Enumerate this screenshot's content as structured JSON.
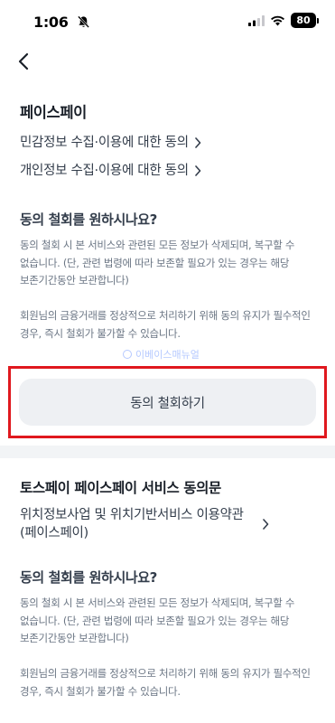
{
  "status_bar": {
    "time": "1:06",
    "battery": "80",
    "icons": [
      "bell-off-icon",
      "signal-icon",
      "wifi-icon",
      "battery-icon"
    ]
  },
  "nav": {
    "back_icon": "chevron-left-icon"
  },
  "face_pay": {
    "title": "페이스페이",
    "links": [
      "민감정보 수집·이용에 대한 동의",
      "개인정보 수집·이용에 대한 동의"
    ],
    "withdraw_question": "동의 철회를 원하시나요?",
    "paragraph1": "동의 철회 시 본 서비스와 관련된 모든 정보가 삭제되며, 복구할 수 없습니다. (단, 관련 법령에 따라 보존할 필요가 있는 경우는 해당 보존기간동안 보관합니다)",
    "paragraph2": "회원님의 금융거래를 정상적으로 처리하기 위해 동의 유지가 필수적인 경우, 즉시 철회가 불가할 수 있습니다.",
    "withdraw_button": "동의 철회하기",
    "highlight_color": "#e0181e"
  },
  "watermark": "이베이스매뉴얼",
  "toss_section": {
    "title": "토스페이 페이스페이 서비스 동의문",
    "link_line1": "위치정보사업 및 위치기반서비스 이용약관",
    "link_line2": "(페이스페이)",
    "withdraw_question": "동의 철회를 원하시나요?",
    "paragraph1": "동의 철회 시 본 서비스와 관련된 모든 정보가 삭제되며, 복구할 수 없습니다. (단, 관련 법령에 따라 보존할 필요가 있는 경우는 해당 보존기간동안 보관합니다)",
    "paragraph2": "회원님의 금융거래를 정상적으로 처리하기 위해 동의 유지가 필수적인 경우, 즉시 철회가 불가할 수 있습니다."
  }
}
